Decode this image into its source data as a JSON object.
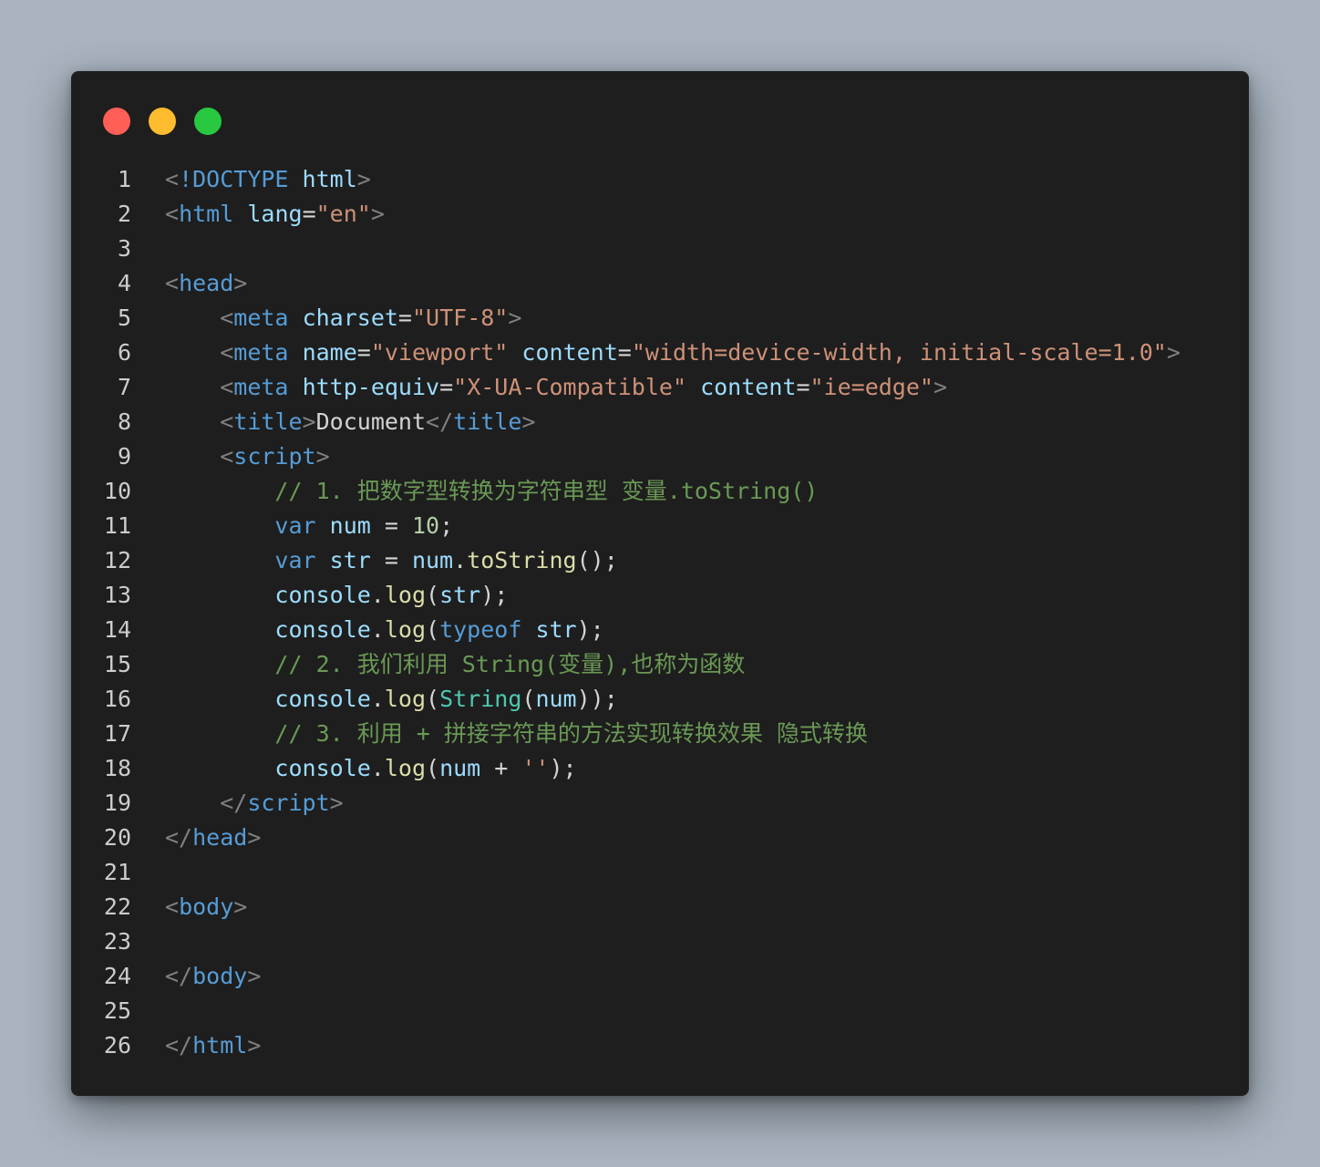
{
  "window": {
    "buttons": {
      "close_color": "#ff5f57",
      "minimize_color": "#febc2e",
      "maximize_color": "#28c840"
    }
  },
  "colors": {
    "background": "#a9b4c0",
    "editor": "#1e1e1e",
    "tag": "#569cd6",
    "attribute": "#9cdcfe",
    "string": "#ce9178",
    "comment": "#6a9955",
    "function": "#dcdcaa",
    "class": "#4ec9b0",
    "number": "#b5cea8"
  },
  "lines": [
    {
      "n": "1",
      "tokens": [
        [
          "pu",
          "<"
        ],
        [
          "tag",
          "!DOCTYPE"
        ],
        [
          "ws",
          " "
        ],
        [
          "attr",
          "html"
        ],
        [
          "pu",
          ">"
        ]
      ]
    },
    {
      "n": "2",
      "tokens": [
        [
          "pu",
          "<"
        ],
        [
          "tag",
          "html"
        ],
        [
          "ws",
          " "
        ],
        [
          "attr",
          "lang"
        ],
        [
          "op",
          "="
        ],
        [
          "str",
          "\"en\""
        ],
        [
          "pu",
          ">"
        ]
      ]
    },
    {
      "n": "3",
      "tokens": []
    },
    {
      "n": "4",
      "tokens": [
        [
          "pu",
          "<"
        ],
        [
          "tag",
          "head"
        ],
        [
          "pu",
          ">"
        ]
      ]
    },
    {
      "n": "5",
      "tokens": [
        [
          "ws",
          "    "
        ],
        [
          "pu",
          "<"
        ],
        [
          "tag",
          "meta"
        ],
        [
          "ws",
          " "
        ],
        [
          "attr",
          "charset"
        ],
        [
          "op",
          "="
        ],
        [
          "str",
          "\"UTF-8\""
        ],
        [
          "pu",
          ">"
        ]
      ]
    },
    {
      "n": "6",
      "tokens": [
        [
          "ws",
          "    "
        ],
        [
          "pu",
          "<"
        ],
        [
          "tag",
          "meta"
        ],
        [
          "ws",
          " "
        ],
        [
          "attr",
          "name"
        ],
        [
          "op",
          "="
        ],
        [
          "str",
          "\"viewport\""
        ],
        [
          "ws",
          " "
        ],
        [
          "attr",
          "content"
        ],
        [
          "op",
          "="
        ],
        [
          "str",
          "\"width=device-width, initial-scale=1.0\""
        ],
        [
          "pu",
          ">"
        ]
      ]
    },
    {
      "n": "7",
      "tokens": [
        [
          "ws",
          "    "
        ],
        [
          "pu",
          "<"
        ],
        [
          "tag",
          "meta"
        ],
        [
          "ws",
          " "
        ],
        [
          "attr",
          "http-equiv"
        ],
        [
          "op",
          "="
        ],
        [
          "str",
          "\"X-UA-Compatible\""
        ],
        [
          "ws",
          " "
        ],
        [
          "attr",
          "content"
        ],
        [
          "op",
          "="
        ],
        [
          "str",
          "\"ie=edge\""
        ],
        [
          "pu",
          ">"
        ]
      ]
    },
    {
      "n": "8",
      "tokens": [
        [
          "ws",
          "    "
        ],
        [
          "pu",
          "<"
        ],
        [
          "tag",
          "title"
        ],
        [
          "pu",
          ">"
        ],
        [
          "tx",
          "Document"
        ],
        [
          "pu",
          "</"
        ],
        [
          "tag",
          "title"
        ],
        [
          "pu",
          ">"
        ]
      ]
    },
    {
      "n": "9",
      "tokens": [
        [
          "ws",
          "    "
        ],
        [
          "pu",
          "<"
        ],
        [
          "tag",
          "script"
        ],
        [
          "pu",
          ">"
        ]
      ]
    },
    {
      "n": "10",
      "tokens": [
        [
          "ws",
          "        "
        ],
        [
          "cm",
          "// 1. 把数字型转换为字符串型 变量.toString()"
        ]
      ]
    },
    {
      "n": "11",
      "tokens": [
        [
          "ws",
          "        "
        ],
        [
          "kw",
          "var"
        ],
        [
          "ws",
          " "
        ],
        [
          "var",
          "num"
        ],
        [
          "op",
          " = "
        ],
        [
          "num",
          "10"
        ],
        [
          "op",
          ";"
        ]
      ]
    },
    {
      "n": "12",
      "tokens": [
        [
          "ws",
          "        "
        ],
        [
          "kw",
          "var"
        ],
        [
          "ws",
          " "
        ],
        [
          "var",
          "str"
        ],
        [
          "op",
          " = "
        ],
        [
          "var",
          "num"
        ],
        [
          "op",
          "."
        ],
        [
          "fn",
          "toString"
        ],
        [
          "op",
          "();"
        ]
      ]
    },
    {
      "n": "13",
      "tokens": [
        [
          "ws",
          "        "
        ],
        [
          "var",
          "console"
        ],
        [
          "op",
          "."
        ],
        [
          "fn",
          "log"
        ],
        [
          "op",
          "("
        ],
        [
          "var",
          "str"
        ],
        [
          "op",
          ");"
        ]
      ]
    },
    {
      "n": "14",
      "tokens": [
        [
          "ws",
          "        "
        ],
        [
          "var",
          "console"
        ],
        [
          "op",
          "."
        ],
        [
          "fn",
          "log"
        ],
        [
          "op",
          "("
        ],
        [
          "kw",
          "typeof"
        ],
        [
          "ws",
          " "
        ],
        [
          "var",
          "str"
        ],
        [
          "op",
          ");"
        ]
      ]
    },
    {
      "n": "15",
      "tokens": [
        [
          "ws",
          "        "
        ],
        [
          "cm",
          "// 2. 我们利用 String(变量),也称为函数"
        ]
      ]
    },
    {
      "n": "16",
      "tokens": [
        [
          "ws",
          "        "
        ],
        [
          "var",
          "console"
        ],
        [
          "op",
          "."
        ],
        [
          "fn",
          "log"
        ],
        [
          "op",
          "("
        ],
        [
          "cls",
          "String"
        ],
        [
          "op",
          "("
        ],
        [
          "var",
          "num"
        ],
        [
          "op",
          "));"
        ]
      ]
    },
    {
      "n": "17",
      "tokens": [
        [
          "ws",
          "        "
        ],
        [
          "cm",
          "// 3. 利用 + 拼接字符串的方法实现转换效果 隐式转换"
        ]
      ]
    },
    {
      "n": "18",
      "tokens": [
        [
          "ws",
          "        "
        ],
        [
          "var",
          "console"
        ],
        [
          "op",
          "."
        ],
        [
          "fn",
          "log"
        ],
        [
          "op",
          "("
        ],
        [
          "var",
          "num"
        ],
        [
          "op",
          " + "
        ],
        [
          "str",
          "''"
        ],
        [
          "op",
          ");"
        ]
      ]
    },
    {
      "n": "19",
      "tokens": [
        [
          "ws",
          "    "
        ],
        [
          "pu",
          "</"
        ],
        [
          "tag",
          "script"
        ],
        [
          "pu",
          ">"
        ]
      ]
    },
    {
      "n": "20",
      "tokens": [
        [
          "pu",
          "</"
        ],
        [
          "tag",
          "head"
        ],
        [
          "pu",
          ">"
        ]
      ]
    },
    {
      "n": "21",
      "tokens": []
    },
    {
      "n": "22",
      "tokens": [
        [
          "pu",
          "<"
        ],
        [
          "tag",
          "body"
        ],
        [
          "pu",
          ">"
        ]
      ]
    },
    {
      "n": "23",
      "tokens": []
    },
    {
      "n": "24",
      "tokens": [
        [
          "pu",
          "</"
        ],
        [
          "tag",
          "body"
        ],
        [
          "pu",
          ">"
        ]
      ]
    },
    {
      "n": "25",
      "tokens": []
    },
    {
      "n": "26",
      "tokens": [
        [
          "pu",
          "</"
        ],
        [
          "tag",
          "html"
        ],
        [
          "pu",
          ">"
        ]
      ]
    }
  ]
}
